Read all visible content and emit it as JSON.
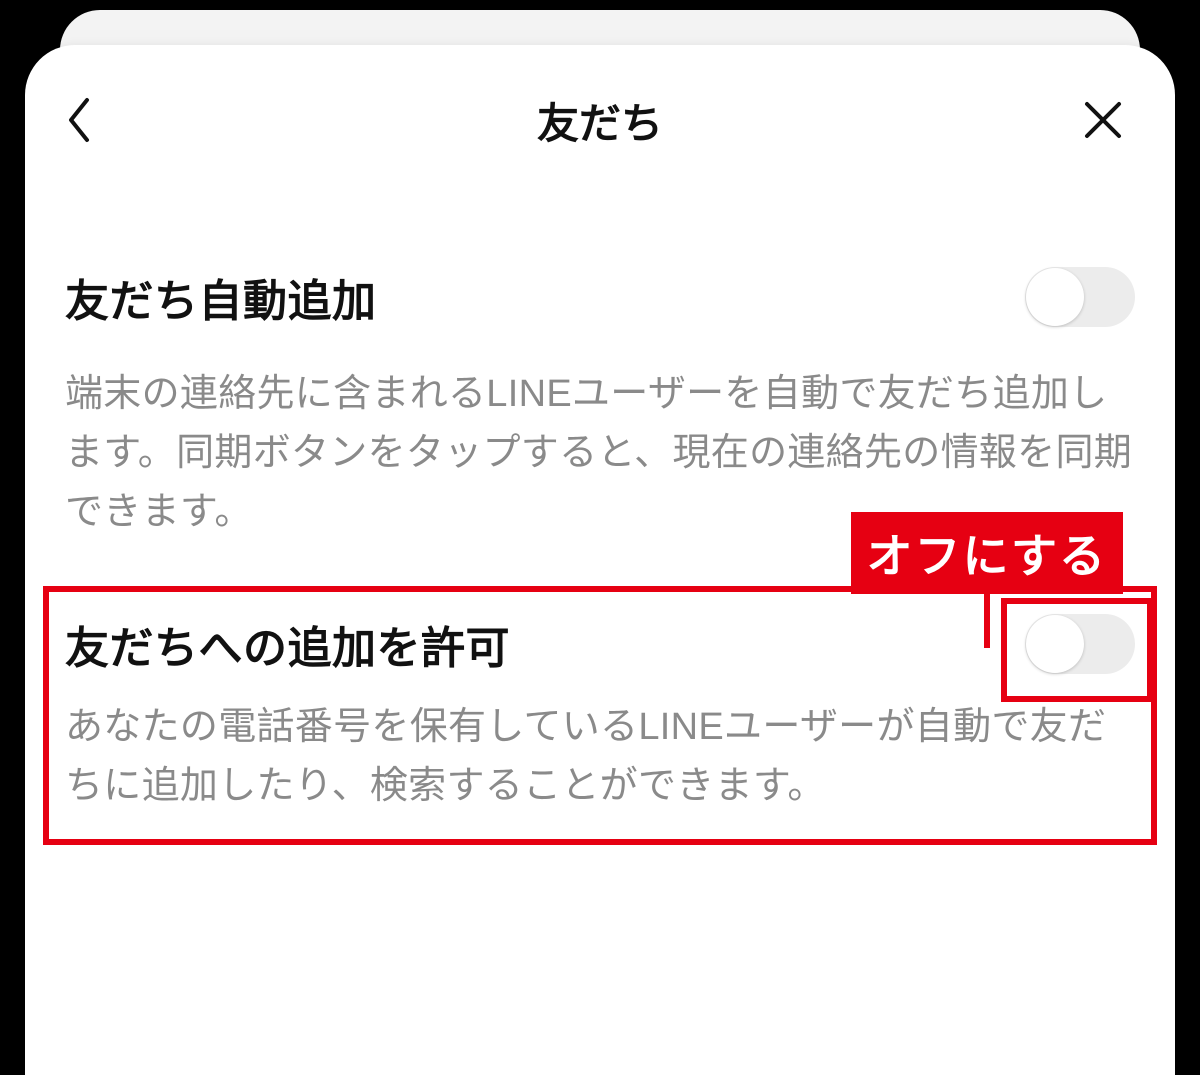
{
  "header": {
    "title": "友だち"
  },
  "settings": {
    "auto_add": {
      "label": "友だち自動追加",
      "description": "端末の連絡先に含まれるLINEユーザーを自動で友だち追加します。同期ボタンをタップすると、現在の連絡先の情報を同期できます。",
      "value": false
    },
    "allow_add": {
      "label": "友だちへの追加を許可",
      "description": "あなたの電話番号を保有しているLINEユーザーが自動で友だちに追加したり、検索することができます。",
      "value": false
    }
  },
  "annotation": {
    "callout": "オフにする"
  }
}
